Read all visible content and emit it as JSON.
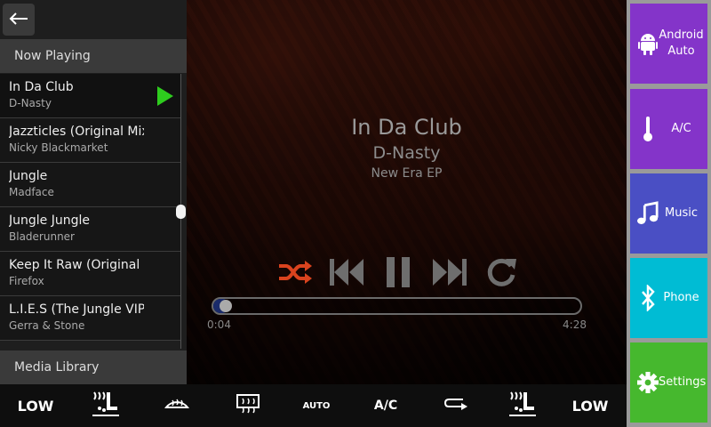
{
  "nav": {
    "back_icon": "arrow-left-icon",
    "now_playing_label": "Now Playing",
    "media_library_label": "Media Library"
  },
  "tracks": [
    {
      "title": "In Da Club",
      "artist": "D-Nasty",
      "playing": true
    },
    {
      "title": "Jazzticles (Original Mix)",
      "artist": "Nicky Blackmarket",
      "playing": false
    },
    {
      "title": "Jungle",
      "artist": "Madface",
      "playing": false
    },
    {
      "title": "Jungle Jungle",
      "artist": "Bladerunner",
      "playing": false
    },
    {
      "title": "Keep It Raw (Original Mix)",
      "artist": "Firefox",
      "playing": false
    },
    {
      "title": "L.I.E.S (The Jungle VIP)",
      "artist": "Gerra & Stone",
      "playing": false
    }
  ],
  "now_playing": {
    "title": "In Da Club",
    "artist": "D-Nasty",
    "album": "New Era EP",
    "elapsed": "0:04",
    "total": "4:28",
    "progress": 0.015
  },
  "controls": [
    "shuffle-icon",
    "previous-icon",
    "pause-icon",
    "next-icon",
    "repeat-icon"
  ],
  "colors": {
    "shuffle_active": "#d9431e",
    "play_marker": "#2ecc1e",
    "android_auto": "#8434c9",
    "ac": "#8434c9",
    "music": "#4a4fc4",
    "phone": "#00bcd4",
    "settings": "#46b82e"
  },
  "side_nav": [
    {
      "label": "Android Auto",
      "icon": "android-icon"
    },
    {
      "label": "A/C",
      "icon": "thermometer-icon"
    },
    {
      "label": "Music",
      "icon": "music-note-icon",
      "selected": true
    },
    {
      "label": "Phone",
      "icon": "bluetooth-icon"
    },
    {
      "label": "Settings",
      "icon": "gear-icon"
    }
  ],
  "climate": {
    "left_fan": "LOW",
    "auto": "AUTO",
    "ac": "A/C",
    "right_fan": "LOW",
    "icons": [
      "seat-heat-left-icon",
      "front-defrost-icon",
      "rear-defrost-icon",
      "recirculate-icon",
      "seat-heat-right-icon"
    ]
  }
}
